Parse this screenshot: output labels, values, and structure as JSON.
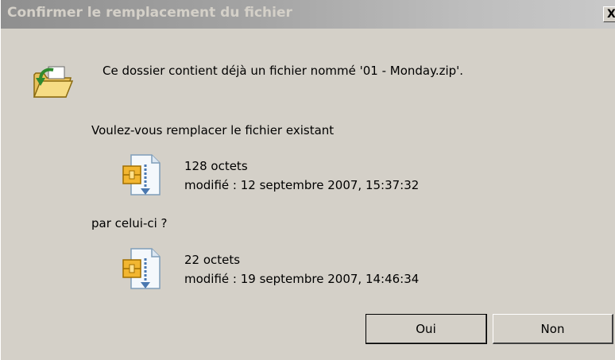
{
  "dialog": {
    "title": "Confirmer le remplacement du fichier",
    "close_label": "X",
    "message": "Ce dossier contient déjà un fichier nommé '01 - Monday.zip'.",
    "question": "Voulez-vous remplacer le fichier existant",
    "existing_file": {
      "size": "128 octets",
      "modified": "modifié : 12 septembre 2007, 15:37:32",
      "icon": "zip-file-icon"
    },
    "by_label": "par celui-ci ?",
    "new_file": {
      "size": "22 octets",
      "modified": "modifié : 19 septembre 2007, 14:46:34",
      "icon": "zip-file-icon"
    },
    "yes_label": "Oui",
    "no_label": "Non"
  },
  "colors": {
    "window_bg": "#d4d0c8",
    "titlebar_start": "#8f8f8f",
    "titlebar_end": "#c9c9c9",
    "title_text": "#d4d0c8"
  }
}
